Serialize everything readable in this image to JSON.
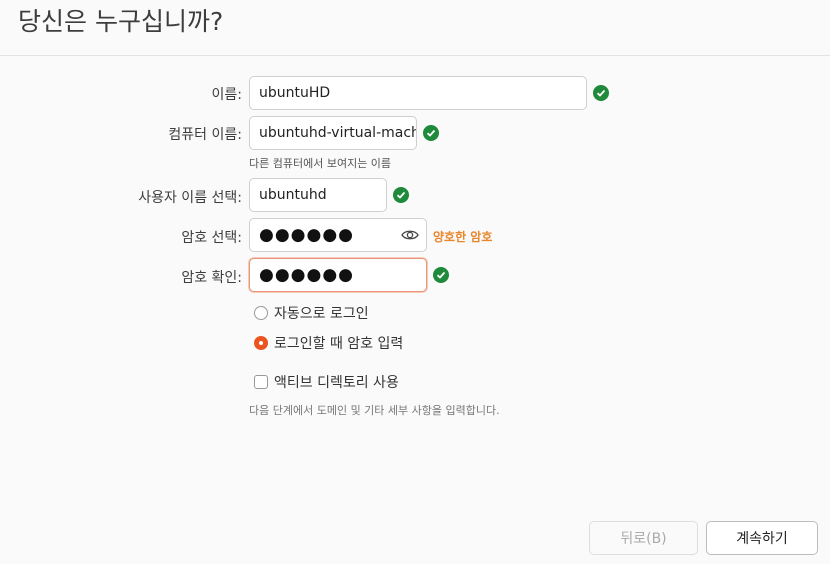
{
  "page": {
    "title": "당신은 누구십니까?"
  },
  "form": {
    "name": {
      "label": "이름:",
      "value": "ubuntuHD"
    },
    "computer": {
      "label": "컴퓨터 이름:",
      "value": "ubuntuhd-virtual-mach",
      "hint": "다른 컴퓨터에서 보여지는 이름"
    },
    "username": {
      "label": "사용자 이름 선택:",
      "value": "ubuntuhd"
    },
    "password": {
      "label": "암호 선택:",
      "value": "●●●●●●",
      "strength": "양호한 암호"
    },
    "confirm": {
      "label": "암호 확인:",
      "value": "●●●●●●"
    }
  },
  "login_options": [
    {
      "label": "자동으로 로그인",
      "selected": false
    },
    {
      "label": "로그인할 때 암호 입력",
      "selected": true
    }
  ],
  "active_directory": {
    "label": "액티브 디렉토리 사용",
    "checked": false,
    "note": "다음 단계에서 도메인 및 기타 세부 사항을 입력합니다."
  },
  "buttons": {
    "back": "뒤로(B)",
    "continue": "계속하기"
  },
  "colors": {
    "accent": "#e95420",
    "success": "#1e8a3a",
    "strength": "#e8862b"
  }
}
